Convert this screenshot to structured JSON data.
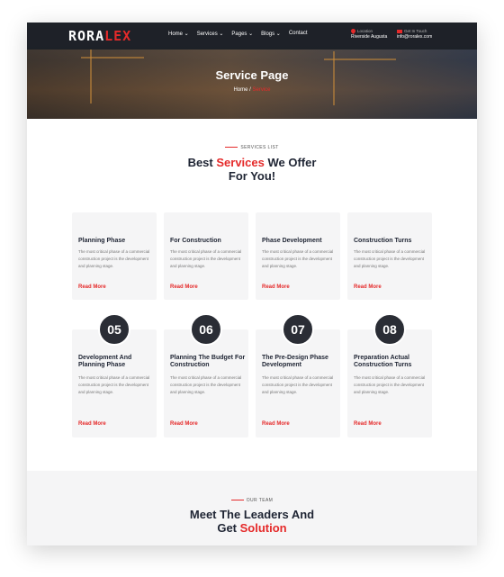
{
  "header": {
    "logo": {
      "main": "RORA",
      "accent": "LEX"
    },
    "nav": [
      {
        "label": "Home ⌄"
      },
      {
        "label": "Services ⌄"
      },
      {
        "label": "Pages ⌄"
      },
      {
        "label": "Blogs ⌄"
      },
      {
        "label": "Contact"
      }
    ],
    "location": {
      "label": "Location",
      "value": "Riverside Augusta"
    },
    "touch": {
      "label": "Get In Touch",
      "value": "info@roralex.com"
    }
  },
  "hero": {
    "title": "Service Page",
    "breadcrumb": {
      "home": "Home",
      "separator": " / ",
      "current": "Service"
    }
  },
  "services": {
    "eyebrow": "SERVICES LIST",
    "heading": {
      "pre": "Best ",
      "accent": "Services",
      "post": " We Offer",
      "line2": "For You!"
    },
    "cards": [
      {
        "title": "Planning Phase",
        "desc": "The most critical phase of a commercial construction project is the development and planning stage.",
        "link": "Read More"
      },
      {
        "title": "For Construction",
        "desc": "The most critical phase of a commercial construction project is the development and planning stage.",
        "link": "Read More"
      },
      {
        "title": "Phase Development",
        "desc": "The most critical phase of a commercial construction project is the development and planning stage.",
        "link": "Read More"
      },
      {
        "title": "Construction Turns",
        "desc": "The most critical phase of a commercial construction project is the development and planning stage.",
        "link": "Read More"
      },
      {
        "number": "05",
        "title": "Development And Planning Phase",
        "desc": "The most critical phase of a commercial construction project is the development and planning stage.",
        "link": "Read More"
      },
      {
        "number": "06",
        "title": "Planning The Budget For Construction",
        "desc": "The most critical phase of a commercial construction project is the development and planning stage.",
        "link": "Read More"
      },
      {
        "number": "07",
        "title": "The Pre-Design Phase Development",
        "desc": "The most critical phase of a commercial construction project is the development and planning stage.",
        "link": "Read More"
      },
      {
        "number": "08",
        "title": "Preparation Actual Construction Turns",
        "desc": "The most critical phase of a commercial construction project is the development and planning stage.",
        "link": "Read More"
      }
    ]
  },
  "team": {
    "eyebrow": "OUR TEAM",
    "heading": {
      "line1": "Meet The Leaders And",
      "pre": "Get ",
      "accent": "Solution"
    }
  },
  "colors": {
    "accent": "#e52a2a",
    "dark": "#1e2433",
    "card_bg": "#f5f5f6",
    "number_circle": "#2a2d35"
  }
}
